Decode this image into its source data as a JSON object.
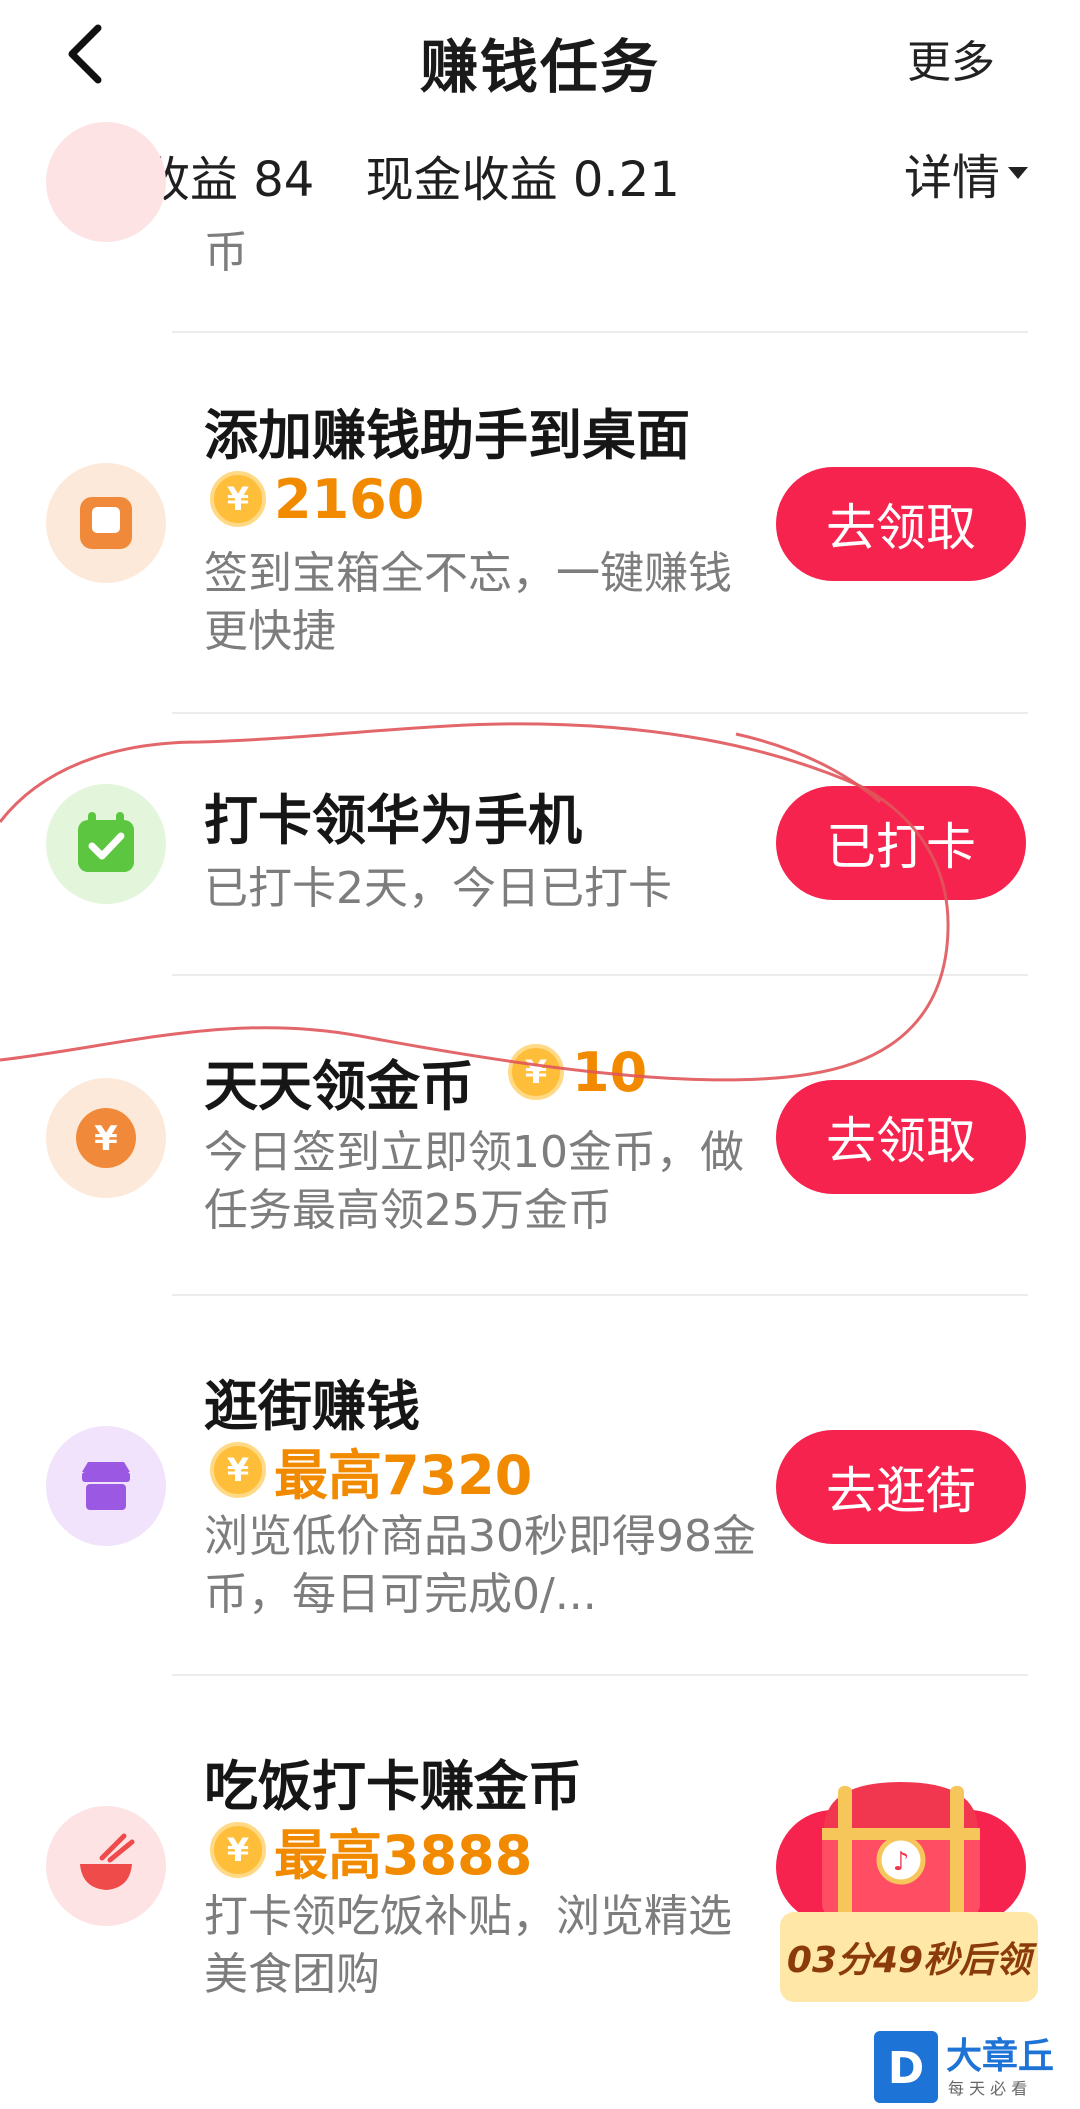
{
  "header": {
    "title": "赚钱任务",
    "more_label": "更多"
  },
  "summary": {
    "coin_income": "金币收益 84",
    "cash_income": "现金收益 0.21",
    "details_label": "详情"
  },
  "partial_row": {
    "desc_tail": "币"
  },
  "tasks": [
    {
      "title": "添加赚钱助手到桌面",
      "reward": "2160",
      "desc": "签到宝箱全不忘，一键赚钱更快捷",
      "button": "去领取",
      "icon": "desktop-square-icon",
      "icon_color": "#f08a3a"
    },
    {
      "title": "打卡领华为手机",
      "desc": "已打卡2天，今日已打卡",
      "button": "已打卡",
      "icon": "calendar-check-icon",
      "icon_color": "#5cc640"
    },
    {
      "title": "天天领金币",
      "reward": "10",
      "desc": "今日签到立即领10金币，做任务最高领25万金币",
      "button": "去领取",
      "icon": "yuan-coin-icon",
      "icon_color": "#f08a3a"
    },
    {
      "title": "逛街赚钱",
      "reward": "最高7320",
      "desc": "浏览低价商品30秒即得98金币，每日可完成0/...",
      "button": "去逛街",
      "icon": "shop-icon",
      "icon_color": "#9b59e3"
    },
    {
      "title": "吃饭打卡赚金币",
      "reward": "最高3888",
      "desc": "打卡领吃饭补贴，浏览精选美食团购",
      "icon": "rice-bowl-icon",
      "icon_color": "#ef4b4b"
    }
  ],
  "chest_timer": "03分49秒后领",
  "watermark": {
    "name": "大章丘",
    "slogan": "每 天 必 看"
  },
  "colors": {
    "accent": "#f5234e",
    "reward": "#f28a00",
    "muted_text": "#7d7d7d"
  }
}
